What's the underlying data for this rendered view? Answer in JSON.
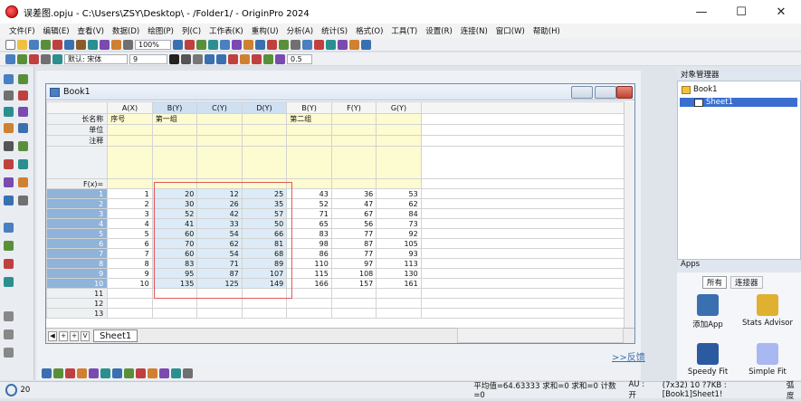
{
  "window": {
    "title": "误差图.opju - C:\\Users\\ZSY\\Desktop\\ - /Folder1/ - OriginPro 2024",
    "min": "—",
    "max": "☐",
    "close": "✕"
  },
  "menu": [
    "文件(F)",
    "编辑(E)",
    "查看(V)",
    "数据(D)",
    "绘图(P)",
    "列(C)",
    "工作表(K)",
    "重构(U)",
    "分析(A)",
    "统计(S)",
    "格式(O)",
    "工具(T)",
    "设置(R)",
    "连接(N)",
    "窗口(W)",
    "帮助(H)"
  ],
  "toolbar": {
    "zoom": "100%",
    "font_label": "默认: 宋体",
    "font_size": "9",
    "line_width": "0.5"
  },
  "book": {
    "title": "Book1",
    "sheet_tab": "Sheet1"
  },
  "grid": {
    "columns": [
      "A(X)",
      "B(Y)",
      "C(Y)",
      "D(Y)",
      "B(Y)",
      "F(Y)",
      "G(Y)"
    ],
    "selected_columns": [
      1,
      2,
      3
    ],
    "label_rows": [
      "长名称",
      "单位",
      "注释",
      "",
      "F(x)="
    ],
    "long_names": [
      "序号",
      "第一组",
      "",
      "",
      "第二组",
      "",
      ""
    ],
    "rows": [
      [
        "1",
        "1",
        "20",
        "12",
        "25",
        "43",
        "36",
        "53"
      ],
      [
        "2",
        "2",
        "30",
        "26",
        "35",
        "52",
        "47",
        "62"
      ],
      [
        "3",
        "3",
        "52",
        "42",
        "57",
        "71",
        "67",
        "84"
      ],
      [
        "4",
        "4",
        "41",
        "33",
        "50",
        "65",
        "56",
        "73"
      ],
      [
        "5",
        "5",
        "60",
        "54",
        "66",
        "83",
        "77",
        "92"
      ],
      [
        "6",
        "6",
        "70",
        "62",
        "81",
        "98",
        "87",
        "105"
      ],
      [
        "7",
        "7",
        "60",
        "54",
        "68",
        "86",
        "77",
        "93"
      ],
      [
        "8",
        "8",
        "83",
        "71",
        "89",
        "110",
        "97",
        "113"
      ],
      [
        "9",
        "9",
        "95",
        "87",
        "107",
        "115",
        "108",
        "130"
      ],
      [
        "10",
        "10",
        "135",
        "125",
        "149",
        "166",
        "157",
        "161"
      ],
      [
        "11",
        "",
        "",
        "",
        "",
        "",
        "",
        ""
      ],
      [
        "12",
        "",
        "",
        "",
        "",
        "",
        "",
        ""
      ],
      [
        "13",
        "",
        "",
        "",
        "",
        "",
        "",
        ""
      ]
    ]
  },
  "project_manager": {
    "title": "对象管理器",
    "folder": "Book1",
    "sheet": "Sheet1"
  },
  "apps": {
    "title": "Apps",
    "tabs": [
      "所有",
      "连接器"
    ],
    "items": [
      "添加App",
      "Stats Advisor",
      "Speedy Fit",
      "Simple Fit"
    ]
  },
  "fanyi": ">>反馈",
  "statusbar": {
    "zoom": "20",
    "stats": "平均值=64.63333 求和=0 求和=0 计数=0",
    "au": "AU : 开",
    "range": "(7x32) 10 ?7KB : [Book1]Sheet1!",
    "mode": "弧度"
  }
}
